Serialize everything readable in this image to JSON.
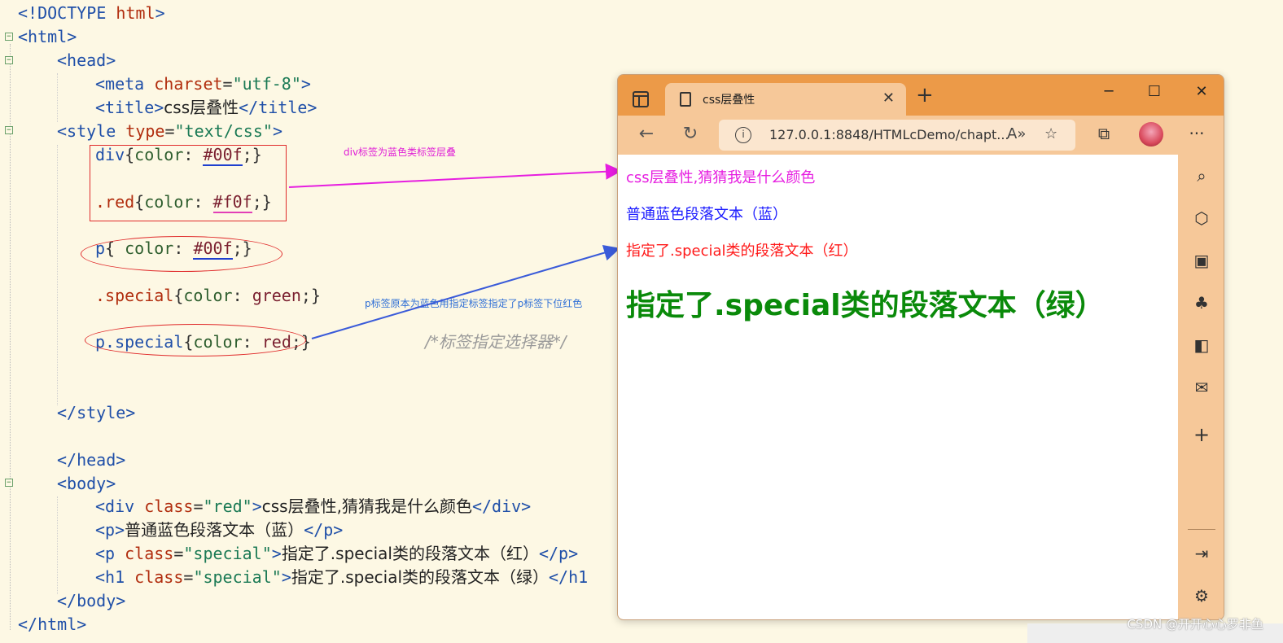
{
  "editor": {
    "lines": {
      "doctype": {
        "open": "<!DOCTYPE ",
        "name": "html",
        "close": ">"
      },
      "html_open": "<html>",
      "head_open": "<head>",
      "meta": {
        "open": "<meta ",
        "attr": "charset",
        "eq": "=",
        "val": "\"utf-8\"",
        "close": ">"
      },
      "title": {
        "open": "<title>",
        "text": "css层叠性",
        "close": "</title>"
      },
      "style_open": {
        "open": "<style ",
        "attr": "type",
        "eq": "=",
        "val": "\"text/css\"",
        "close": ">"
      },
      "rule_div": {
        "sel": "div",
        "lb": "{",
        "prop": "color",
        "colon": ": ",
        "val": "#00f",
        "end": ";}"
      },
      "rule_red": {
        "sel": ".red",
        "lb": "{",
        "prop": "color",
        "colon": ": ",
        "val": "#f0f",
        "end": ";}"
      },
      "rule_p": {
        "sel": "p",
        "lb": "{ ",
        "prop": "color",
        "colon": ": ",
        "val": "#00f",
        "end": ";}"
      },
      "rule_special": {
        "sel": ".special",
        "lb": "{",
        "prop": "color",
        "colon": ": ",
        "val": "green",
        "end": ";}"
      },
      "rule_pspecial": {
        "sel": "p.special",
        "lb": "{",
        "prop": "color",
        "colon": ": ",
        "val": "red",
        "end": ";}"
      },
      "comment": "/*标签指定选择器*/",
      "style_close": "</style>",
      "head_close": "</head>",
      "body_open": "<body>",
      "b_div": {
        "open": "<div ",
        "attr": "class",
        "eq": "=",
        "val": "\"red\"",
        "gt": ">",
        "text": "css层叠性,猜猜我是什么颜色",
        "close": "</div>"
      },
      "b_p1": {
        "open": "<p>",
        "text": "普通蓝色段落文本（蓝）",
        "close": "</p>"
      },
      "b_p2": {
        "open": "<p ",
        "attr": "class",
        "eq": "=",
        "val": "\"special\"",
        "gt": ">",
        "text": "指定了.special类的段落文本（红）",
        "close": "</p>"
      },
      "b_h1": {
        "open": "<h1 ",
        "attr": "class",
        "eq": "=",
        "val": "\"special\"",
        "gt": ">",
        "text": "指定了.special类的段落文本（绿）",
        "close": "</h1"
      },
      "body_close": "</body>",
      "html_close": "</html>"
    },
    "annotations": {
      "note_div": "div标签为蓝色类标签层叠",
      "note_p": "p标签原本为蓝色用指定标签指定了p标签下位红色"
    },
    "colors": {
      "note_div": "#e01fd6",
      "note_p": "#2f6fd6",
      "arrow_pink": "#e61ee0",
      "arrow_blue": "#3a5bd9",
      "box": "#e02b2b"
    }
  },
  "browser": {
    "tab_title": "css层叠性",
    "url": "127.0.0.1:8848/HTMLcDemo/chapt...",
    "page": {
      "div_text": "css层叠性,猜猜我是什么颜色",
      "p1_text": "普通蓝色段落文本（蓝）",
      "p2_text": "指定了.special类的段落文本（红）",
      "h1_text": "指定了.special类的段落文本（绿）",
      "colors": {
        "div": "#e61ee0",
        "p1": "#1a1aff",
        "p2": "#ff1a1a",
        "h1": "#0a8a0a"
      }
    },
    "icons": {
      "tab_strip": "tab-actions-icon",
      "tab_page": "page-icon",
      "tab_close": "✕",
      "new_tab": "+",
      "minimize": "─",
      "maximize": "☐",
      "close": "✕",
      "back": "←",
      "refresh": "↻",
      "info": "i",
      "read_aloud": "A»",
      "favorite": "☆",
      "collections": "⧉",
      "more": "···",
      "side_search": "⌕",
      "side_tag": "⬡",
      "side_tools": "▣",
      "side_games": "♣",
      "side_office": "◧",
      "side_outlook": "✉",
      "side_add": "+",
      "side_panel": "⇥",
      "side_settings": "⚙"
    }
  },
  "watermark": "CSDN @开开心心罗非鱼"
}
